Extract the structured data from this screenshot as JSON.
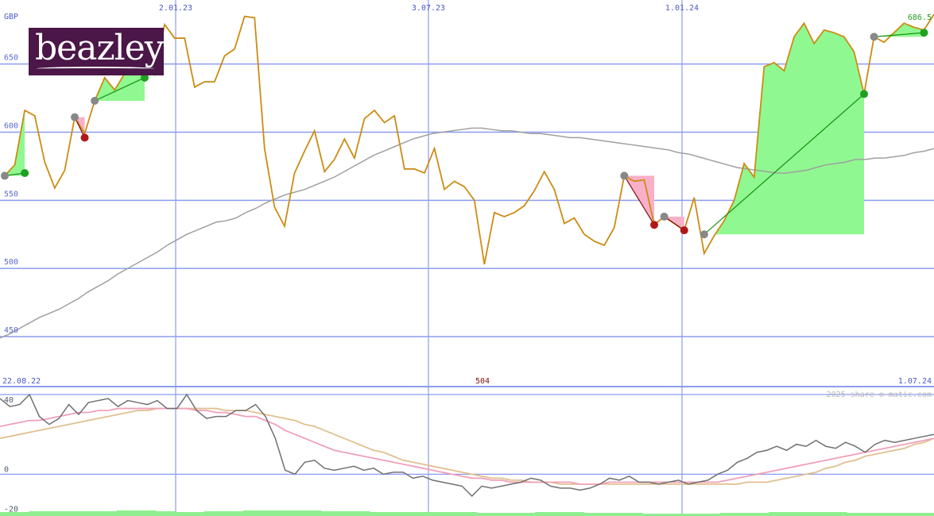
{
  "logo": {
    "text": "beazley",
    "color": "#4b1648"
  },
  "header": {
    "currency": "GBP",
    "last_price": "686.5",
    "date_labels": [
      "2.01.23",
      "3.07.23",
      "1.01.24"
    ]
  },
  "footer": {
    "start_date": "22.08.22",
    "end_date": "1.07.24",
    "center_value": "504",
    "credit": "2025 share-o-matic.com"
  },
  "colors": {
    "price": "#cc8c14",
    "ma": "#a0a0a0",
    "grid": "#8c9cf0",
    "gain_fill": "#90f890",
    "loss_fill": "#f8b0c8",
    "gain_line": "#109010",
    "loss_line": "#801010",
    "osc": "#707070",
    "osc_fast": "#f0a0b8",
    "osc_slow": "#e0c090",
    "volume": "#90ee90"
  },
  "chart_data": [
    {
      "type": "line",
      "title": "",
      "ylabel": "GBP",
      "y_ticks": [
        450,
        500,
        550,
        600,
        650
      ],
      "ylim": [
        429,
        697
      ],
      "x_ticks": [
        "2.01.23",
        "3.07.23",
        "1.01.24"
      ],
      "grid": true,
      "series": [
        {
          "values": [
            568,
            576,
            616,
            612,
            578,
            559,
            572,
            611,
            599,
            623,
            640,
            631,
            643,
            645,
            648,
            642,
            679,
            669,
            669,
            633,
            637,
            637,
            656,
            661,
            685,
            684,
            588,
            545,
            531,
            570,
            586,
            601,
            571,
            580,
            595,
            581,
            610,
            616,
            607,
            612,
            573,
            573,
            570,
            588,
            558,
            564,
            560,
            550,
            503,
            541,
            538,
            541,
            546,
            557,
            571,
            558,
            533,
            537,
            525,
            520,
            517,
            530,
            568,
            564,
            565,
            532,
            538,
            533,
            528,
            552,
            511,
            524,
            535,
            550,
            577,
            567,
            648,
            651,
            645,
            670,
            680,
            665,
            675,
            673,
            670,
            659,
            628,
            670,
            666,
            673,
            680,
            677,
            675,
            686.5
          ]
        },
        {
          "values": [
            449,
            452,
            456,
            460,
            464,
            467,
            470,
            474,
            478,
            483,
            487,
            491,
            496,
            500,
            504,
            508,
            512,
            517,
            521,
            525,
            528,
            531,
            534,
            535,
            537,
            541,
            544,
            548,
            551,
            554,
            556,
            558,
            561,
            564,
            567,
            571,
            575,
            579,
            583,
            586,
            589,
            592,
            595,
            597,
            599,
            600,
            601,
            602,
            603,
            603,
            602,
            601,
            601,
            600,
            599,
            599,
            598,
            597,
            596,
            596,
            595,
            594,
            593,
            592,
            591,
            590,
            589,
            588,
            587,
            585,
            584,
            582,
            580,
            578,
            576,
            574,
            573,
            572,
            571,
            570,
            570,
            571,
            572,
            574,
            576,
            577,
            578,
            580,
            580,
            581,
            581,
            582,
            583,
            585,
            586,
            588
          ]
        }
      ],
      "trades": [
        {
          "kind": "gain",
          "entry": 568,
          "exit": 570
        },
        {
          "kind": "loss",
          "entry": 611,
          "exit": 596
        },
        {
          "kind": "gain",
          "entry": 623,
          "exit": 640
        },
        {
          "kind": "loss",
          "entry": 568,
          "exit": 532
        },
        {
          "kind": "loss",
          "entry": 538,
          "exit": 528
        },
        {
          "kind": "gain",
          "entry": 525,
          "exit": 628
        },
        {
          "kind": "gain",
          "entry": 670,
          "exit": 673
        }
      ]
    },
    {
      "type": "line",
      "title": "",
      "y_ticks": [
        40,
        0,
        -20
      ],
      "ylim": [
        -21,
        44
      ],
      "x_ticks": [
        "22.08.22",
        "1.07.24"
      ],
      "grid": true,
      "series": [
        {
          "values": [
            38,
            34,
            35,
            40,
            29,
            25,
            28,
            35,
            30,
            36,
            37,
            38,
            34,
            37,
            36,
            35,
            37,
            33,
            33,
            40,
            32,
            28,
            29,
            29,
            32,
            32,
            35,
            29,
            18,
            2,
            0,
            6,
            7,
            3,
            2,
            3,
            4,
            2,
            3,
            0,
            1,
            1,
            -2,
            -1,
            -3,
            -4,
            -5,
            -6,
            -11,
            -6,
            -7,
            -6,
            -5,
            -4,
            -2,
            -3,
            -6,
            -7,
            -7,
            -8,
            -7,
            -5,
            -2,
            -3,
            -1,
            -4,
            -4,
            -5,
            -4,
            -3,
            -5,
            -4,
            -3,
            0,
            2,
            6,
            8,
            11,
            12,
            14,
            12,
            15,
            14,
            17,
            14,
            13,
            16,
            14,
            11,
            15,
            17,
            16,
            17,
            18,
            19,
            20
          ]
        },
        {
          "values": [
            24,
            25,
            26,
            27,
            27,
            28,
            29,
            30,
            31,
            31,
            32,
            32,
            33,
            33,
            33,
            33,
            33,
            33,
            33,
            33,
            32,
            32,
            31,
            31,
            30,
            29,
            29,
            27,
            25,
            22,
            20,
            18,
            16,
            14,
            12,
            11,
            10,
            9,
            8,
            7,
            6,
            5,
            4,
            3,
            2,
            1,
            0,
            -1,
            -2,
            -2,
            -3,
            -3,
            -4,
            -4,
            -4,
            -4,
            -4,
            -4,
            -4,
            -5,
            -5,
            -5,
            -4,
            -4,
            -4,
            -4,
            -4,
            -4,
            -4,
            -4,
            -4,
            -4,
            -4,
            -4,
            -3,
            -2,
            -1,
            0,
            1,
            2,
            3,
            4,
            5,
            6,
            7,
            8,
            9,
            10,
            11,
            12,
            13,
            14,
            15,
            16,
            17,
            18
          ]
        },
        {
          "values": [
            18,
            19,
            20,
            21,
            22,
            23,
            24,
            25,
            26,
            27,
            28,
            29,
            30,
            31,
            32,
            32,
            33,
            33,
            33,
            33,
            33,
            33,
            33,
            32,
            32,
            32,
            31,
            30,
            29,
            28,
            27,
            25,
            24,
            22,
            20,
            18,
            16,
            14,
            12,
            11,
            9,
            7,
            6,
            5,
            4,
            3,
            2,
            1,
            0,
            -1,
            -2,
            -2,
            -3,
            -3,
            -4,
            -4,
            -4,
            -5,
            -5,
            -5,
            -5,
            -5,
            -5,
            -5,
            -5,
            -5,
            -5,
            -5,
            -5,
            -5,
            -5,
            -5,
            -5,
            -5,
            -5,
            -5,
            -4,
            -4,
            -4,
            -3,
            -2,
            -1,
            0,
            1,
            3,
            4,
            6,
            7,
            9,
            10,
            11,
            12,
            13,
            15,
            16,
            18
          ]
        }
      ],
      "volume": [
        5,
        5,
        5,
        6,
        6,
        6,
        6,
        6,
        6,
        6,
        6,
        6,
        7,
        7,
        7,
        7,
        6,
        6,
        5,
        5,
        5,
        6,
        6,
        6,
        6,
        7,
        7,
        7,
        7,
        7,
        7,
        7,
        7,
        6,
        6,
        6,
        6,
        6,
        5,
        5,
        5,
        5,
        5,
        5,
        5,
        5,
        5,
        5,
        5,
        4,
        4,
        4,
        4,
        4,
        4,
        5,
        5,
        5,
        5,
        5,
        4,
        4,
        4,
        4,
        4,
        4,
        3,
        3,
        3,
        3,
        3,
        3,
        3,
        3,
        4,
        4,
        4,
        4,
        4,
        5,
        5,
        5,
        5,
        5,
        5,
        5,
        5,
        4,
        4,
        4,
        4,
        4,
        4,
        4,
        4,
        4
      ]
    }
  ]
}
